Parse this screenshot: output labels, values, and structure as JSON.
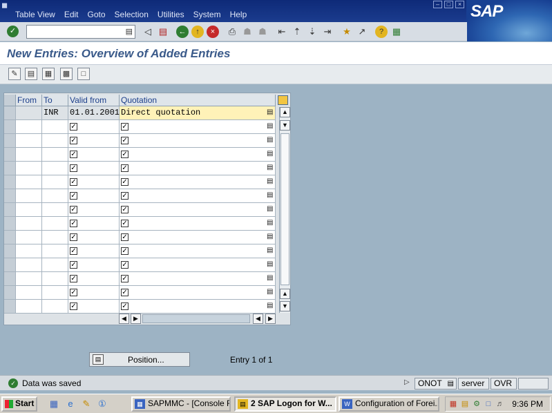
{
  "window": {
    "menus": [
      {
        "label": "Table View"
      },
      {
        "label": "Edit"
      },
      {
        "label": "Goto"
      },
      {
        "label": "Selection"
      },
      {
        "label": "Utilities"
      },
      {
        "label": "System"
      },
      {
        "label": "Help"
      }
    ],
    "logo_text": "SAP"
  },
  "toolbar": {
    "command_field_value": "",
    "icons": [
      "enter-icon",
      "back-nav-icon",
      "save-icon",
      "back-icon",
      "exit-icon",
      "cancel-icon",
      "print-icon",
      "find-icon",
      "find-next-icon",
      "first-page-icon",
      "previous-page-icon",
      "next-page-icon",
      "last-page-icon",
      "create-session-icon",
      "create-shortcut-icon",
      "help-icon",
      "layout-menu-icon"
    ]
  },
  "title": "New Entries: Overview of Added Entries",
  "app_toolbar": {
    "icons": [
      "change-display-icon",
      "delete-icon",
      "select-all-icon",
      "select-block-icon",
      "deselect-all-icon"
    ]
  },
  "table": {
    "columns": [
      "From",
      "To",
      "Valid from",
      "Quotation"
    ],
    "rows": [
      {
        "from": "",
        "to": "INR",
        "valid_from": "01.01.2001",
        "quotation": "Direct quotation"
      },
      {
        "from": "",
        "to": "",
        "valid_from": "",
        "quotation": ""
      },
      {
        "from": "",
        "to": "",
        "valid_from": "",
        "quotation": ""
      },
      {
        "from": "",
        "to": "",
        "valid_from": "",
        "quotation": ""
      },
      {
        "from": "",
        "to": "",
        "valid_from": "",
        "quotation": ""
      },
      {
        "from": "",
        "to": "",
        "valid_from": "",
        "quotation": ""
      },
      {
        "from": "",
        "to": "",
        "valid_from": "",
        "quotation": ""
      },
      {
        "from": "",
        "to": "",
        "valid_from": "",
        "quotation": ""
      },
      {
        "from": "",
        "to": "",
        "valid_from": "",
        "quotation": ""
      },
      {
        "from": "",
        "to": "",
        "valid_from": "",
        "quotation": ""
      },
      {
        "from": "",
        "to": "",
        "valid_from": "",
        "quotation": ""
      },
      {
        "from": "",
        "to": "",
        "valid_from": "",
        "quotation": ""
      },
      {
        "from": "",
        "to": "",
        "valid_from": "",
        "quotation": ""
      },
      {
        "from": "",
        "to": "",
        "valid_from": "",
        "quotation": ""
      },
      {
        "from": "",
        "to": "",
        "valid_from": "",
        "quotation": ""
      }
    ]
  },
  "position_button": "Position...",
  "entry_info": "Entry 1 of 1",
  "status": {
    "message": "Data was saved",
    "transaction": "ONOT",
    "server": "server",
    "mode": "OVR"
  },
  "taskbar": {
    "start_label": "Start",
    "tasks": [
      {
        "label": "SAPMMC - [Console R..."
      },
      {
        "label": "2 SAP Logon for W..."
      },
      {
        "label": "Configuration of Forei..."
      }
    ],
    "clock": "9:36 PM"
  }
}
